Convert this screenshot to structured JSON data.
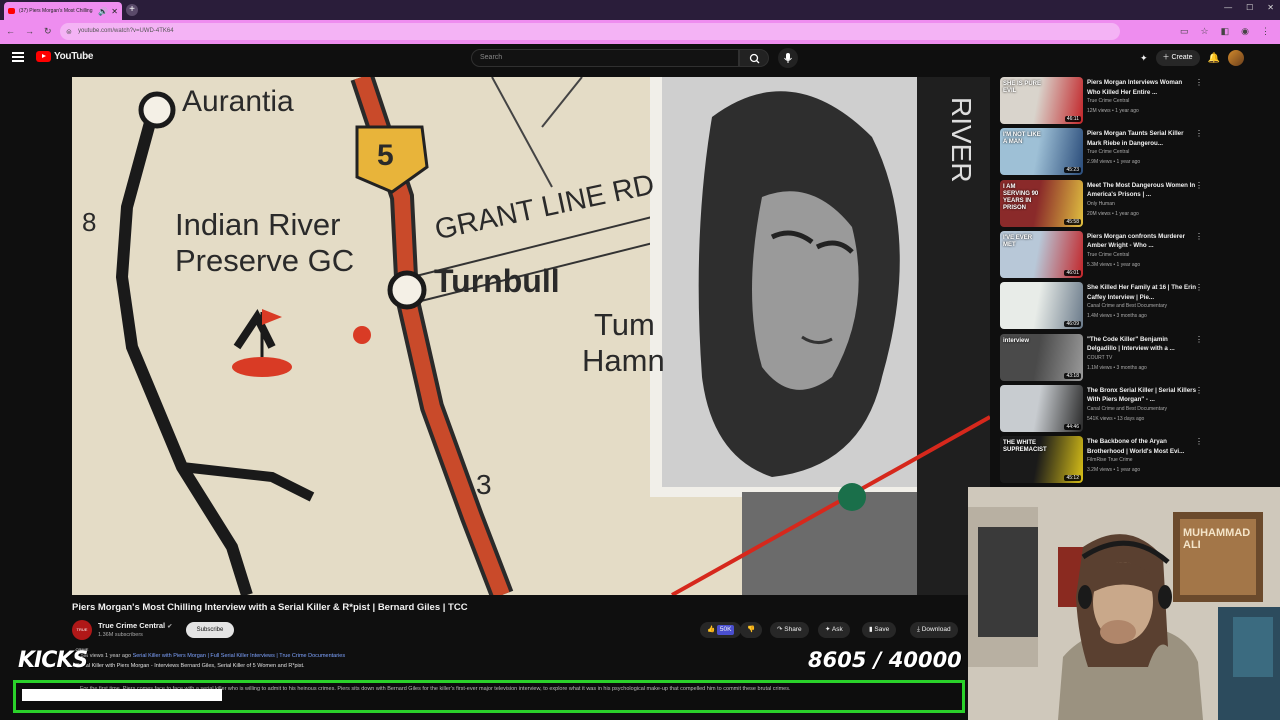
{
  "browser": {
    "tab_title": "(37) Piers Morgan's Most Chilling",
    "new_tab_symbol": "+",
    "url": "youtube.com/watch?v=UWD-4TK64"
  },
  "header": {
    "logo_text": "YouTube",
    "search_placeholder": "Search",
    "create_label": "Create"
  },
  "player": {
    "map_labels": {
      "aurantia": "Aurantia",
      "indian_river": "Indian River",
      "preserve": "Preserve GC",
      "grant_line": "GRANT LINE RD",
      "turnbull": "Turnbull",
      "tum": "Tum",
      "hamn": "Hamn",
      "num8": "8",
      "num3": "3",
      "shield5": "5",
      "river": "RIVER"
    }
  },
  "video": {
    "title": "Piers Morgan's Most Chilling Interview with a Serial Killer & R*pist | Bernard Giles | TCC",
    "channel": "True Crime Central",
    "channel_avatar_text": "TRUE CRIME",
    "subscribers": "1.36M subscribers",
    "subscribe_label": "Subscribe",
    "like_count": "50K",
    "share_label": "Share",
    "ask_label": "Ask",
    "save_label": "Save",
    "download_label": "Download",
    "meta": "1.5M views  1 year ago",
    "meta_tags": "Serial Killer with Piers Morgan | Full Serial Killer Interviews | True Crime Documentaries",
    "description": "Serial Killer with Piers Morgan - Interviews Bernard Giles, Serial Killer of 5 Women and R*pist."
  },
  "overlay": {
    "kicks_label": "KICKS",
    "counter": "8605 / 40000",
    "ticker": "For the first time, Piers comes face to face with a serial killer who is willing to admit to his heinous crimes. Piers sits down with Bernard Giles for the killer's first-ever major television interview, to explore what it was in his psychological make-up that compelled him to commit these brutal crimes."
  },
  "sidebar": {
    "items": [
      {
        "title": "Piers Morgan Interviews Woman Who Killed Her Entire ...",
        "channel": "True Crime Central",
        "views": "12M views • 1 year ago",
        "duration": "46:11",
        "thumb_text": "SHE IS PURE EVIL"
      },
      {
        "title": "Piers Morgan Taunts Serial Killer Mark Riebe in Dangerou...",
        "channel": "True Crime Central",
        "views": "2.9M views • 1 year ago",
        "duration": "45:23",
        "thumb_text": "I'M NOT LIKE A MAN"
      },
      {
        "title": "Meet The Most Dangerous Women In America's Prisons | ...",
        "channel": "Only Human",
        "views": "20M views • 1 year ago",
        "duration": "45:58",
        "thumb_text": "I AM SERVING 90 YEARS IN PRISON"
      },
      {
        "title": "Piers Morgan confronts Murderer Amber Wright - Who ...",
        "channel": "True Crime Central",
        "views": "5.3M views • 1 year ago",
        "duration": "46:01",
        "thumb_text": "I'VE EVER MET"
      },
      {
        "title": "She Killed Her Family at 16 | The Erin Caffey Interview | Pie...",
        "channel": "Canal Crime  and Best Documentary",
        "views": "1.4M views • 3 months ago",
        "duration": "46:09",
        "thumb_text": ""
      },
      {
        "title": "\"The Code Killer\" Benjamin Delgadillo | Interview with a ...",
        "channel": "COURT TV",
        "views": "1.1M views • 3 months ago",
        "duration": "43:18",
        "thumb_text": "interview"
      },
      {
        "title": "The Bronx Serial Killer | Serial Killers With Piers Morgan\" - ...",
        "channel": "Canal Crime  and Best Documentary",
        "views": "541K views • 13 days ago",
        "duration": "44:46",
        "thumb_text": ""
      },
      {
        "title": "The Backbone of the Aryan Brotherhood | World's Most Evi...",
        "channel": "FilmRise True Crime",
        "views": "3.2M views • 1 year ago",
        "duration": "45:12",
        "thumb_text": "THE WHITE SUPREMACIST"
      }
    ]
  },
  "webcam": {
    "poster_text": "MUHAMMAD ALI"
  }
}
